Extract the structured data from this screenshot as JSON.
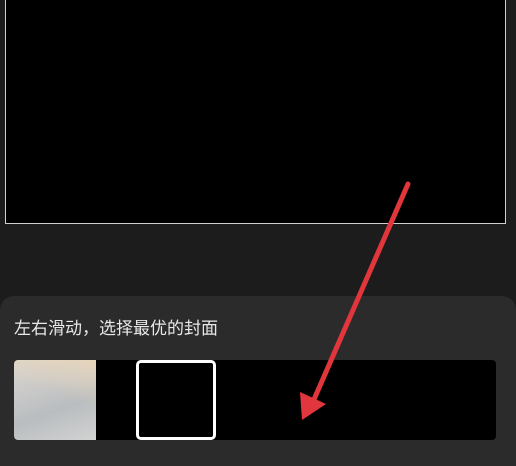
{
  "cover_picker": {
    "hint": "左右滑动，选择最优的封面",
    "frames": [
      {
        "label": "frame-1-thumbnail"
      },
      {
        "label": "frame-2-empty"
      }
    ],
    "selected_frame_index": 1
  },
  "annotation": {
    "arrow_color": "#e0363c"
  }
}
